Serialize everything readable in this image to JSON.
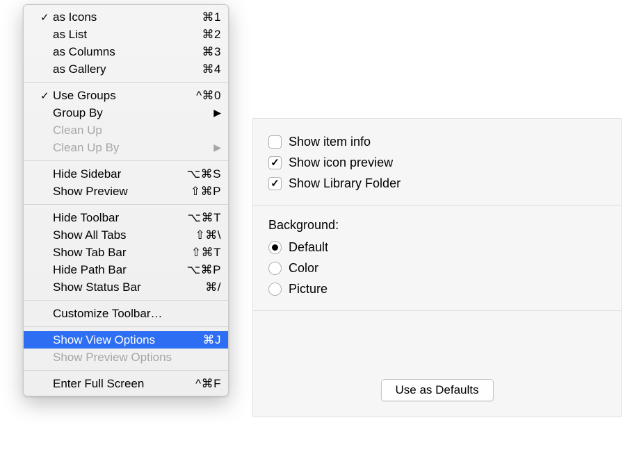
{
  "menu": {
    "groups": [
      [
        {
          "id": "as-icons",
          "label": "as Icons",
          "shortcut": "⌘1",
          "checked": true,
          "enabled": true,
          "submenu": false
        },
        {
          "id": "as-list",
          "label": "as List",
          "shortcut": "⌘2",
          "checked": false,
          "enabled": true,
          "submenu": false
        },
        {
          "id": "as-columns",
          "label": "as Columns",
          "shortcut": "⌘3",
          "checked": false,
          "enabled": true,
          "submenu": false
        },
        {
          "id": "as-gallery",
          "label": "as Gallery",
          "shortcut": "⌘4",
          "checked": false,
          "enabled": true,
          "submenu": false
        }
      ],
      [
        {
          "id": "use-groups",
          "label": "Use Groups",
          "shortcut": "^⌘0",
          "checked": true,
          "enabled": true,
          "submenu": false
        },
        {
          "id": "group-by",
          "label": "Group By",
          "shortcut": "",
          "checked": false,
          "enabled": true,
          "submenu": true
        },
        {
          "id": "clean-up",
          "label": "Clean Up",
          "shortcut": "",
          "checked": false,
          "enabled": false,
          "submenu": false
        },
        {
          "id": "clean-up-by",
          "label": "Clean Up By",
          "shortcut": "",
          "checked": false,
          "enabled": false,
          "submenu": true
        }
      ],
      [
        {
          "id": "hide-sidebar",
          "label": "Hide Sidebar",
          "shortcut": "⌥⌘S",
          "checked": false,
          "enabled": true,
          "submenu": false
        },
        {
          "id": "show-preview",
          "label": "Show Preview",
          "shortcut": "⇧⌘P",
          "checked": false,
          "enabled": true,
          "submenu": false
        }
      ],
      [
        {
          "id": "hide-toolbar",
          "label": "Hide Toolbar",
          "shortcut": "⌥⌘T",
          "checked": false,
          "enabled": true,
          "submenu": false
        },
        {
          "id": "show-all-tabs",
          "label": "Show All Tabs",
          "shortcut": "⇧⌘\\",
          "checked": false,
          "enabled": true,
          "submenu": false
        },
        {
          "id": "show-tab-bar",
          "label": "Show Tab Bar",
          "shortcut": "⇧⌘T",
          "checked": false,
          "enabled": true,
          "submenu": false
        },
        {
          "id": "hide-path-bar",
          "label": "Hide Path Bar",
          "shortcut": "⌥⌘P",
          "checked": false,
          "enabled": true,
          "submenu": false
        },
        {
          "id": "show-status-bar",
          "label": "Show Status Bar",
          "shortcut": "⌘/",
          "checked": false,
          "enabled": true,
          "submenu": false
        }
      ],
      [
        {
          "id": "customize-toolbar",
          "label": "Customize Toolbar…",
          "shortcut": "",
          "checked": false,
          "enabled": true,
          "submenu": false
        }
      ],
      [
        {
          "id": "show-view-options",
          "label": "Show View Options",
          "shortcut": "⌘J",
          "checked": false,
          "enabled": true,
          "submenu": false,
          "highlighted": true
        },
        {
          "id": "show-preview-options",
          "label": "Show Preview Options",
          "shortcut": "",
          "checked": false,
          "enabled": false,
          "submenu": false
        }
      ],
      [
        {
          "id": "enter-full-screen",
          "label": "Enter Full Screen",
          "shortcut": "^⌘F",
          "checked": false,
          "enabled": true,
          "submenu": false
        }
      ]
    ]
  },
  "options": {
    "checkboxes": [
      {
        "id": "show-item-info",
        "label": "Show item info",
        "checked": false
      },
      {
        "id": "show-icon-preview",
        "label": "Show icon preview",
        "checked": true
      },
      {
        "id": "show-library-folder",
        "label": "Show Library Folder",
        "checked": true
      }
    ],
    "background_label": "Background:",
    "background": [
      {
        "id": "bg-default",
        "label": "Default",
        "selected": true
      },
      {
        "id": "bg-color",
        "label": "Color",
        "selected": false
      },
      {
        "id": "bg-picture",
        "label": "Picture",
        "selected": false
      }
    ],
    "defaults_button": "Use as Defaults"
  }
}
